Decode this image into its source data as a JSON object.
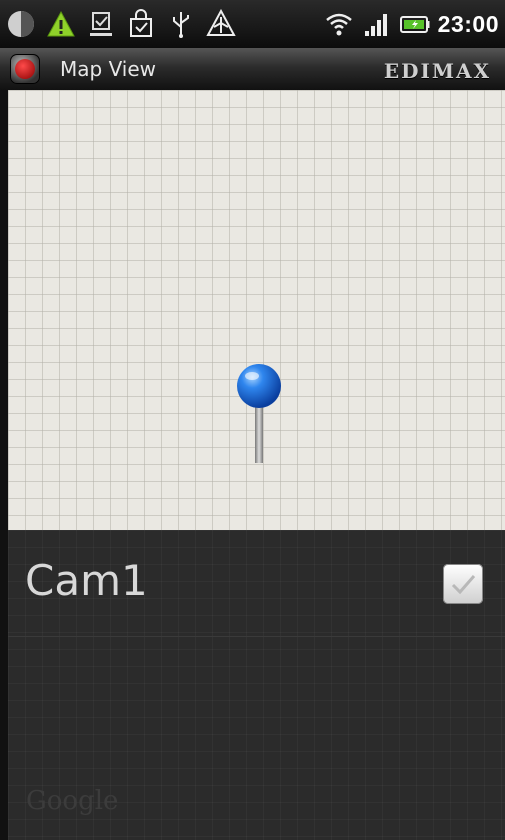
{
  "status_bar": {
    "time": "23:00",
    "icons": [
      "sync-icon",
      "warning-icon",
      "download-icon",
      "shopping-bag-icon",
      "usb-icon",
      "airplane-icon",
      "wifi-icon",
      "signal-icon",
      "battery-icon"
    ]
  },
  "title_bar": {
    "title": "Map View",
    "brand": "EDIMAX"
  },
  "camera": {
    "name": "Cam1",
    "checked": true
  },
  "map": {
    "attribution": "Google"
  },
  "colors": {
    "pin": "#1a6ee0",
    "map_bg": "#eae8e2",
    "panel_bg": "#2b2b2b"
  }
}
